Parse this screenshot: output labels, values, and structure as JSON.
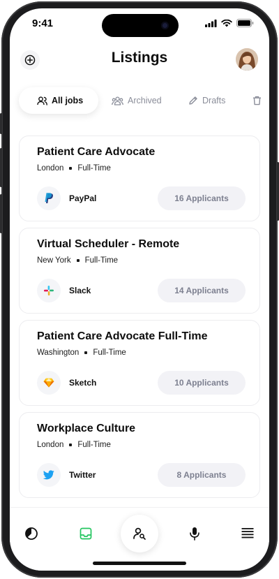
{
  "status_bar": {
    "time": "9:41"
  },
  "header": {
    "title": "Listings",
    "add_icon": "plus-circle-icon",
    "avatar_alt": "profile"
  },
  "tabs": [
    {
      "label": "All jobs",
      "icon": "users-icon",
      "active": true
    },
    {
      "label": "Archived",
      "icon": "group-icon",
      "active": false
    },
    {
      "label": "Drafts",
      "icon": "pencil-icon",
      "active": false
    },
    {
      "label": "",
      "icon": "trash-icon",
      "active": false
    }
  ],
  "listings": [
    {
      "title": "Patient Care Advocate",
      "location": "London",
      "type": "Full-Time",
      "company": "PayPal",
      "logo": "paypal-logo",
      "applicants": "16 Applicants"
    },
    {
      "title": "Virtual Scheduler - Remote",
      "location": "New York",
      "type": "Full-Time",
      "company": "Slack",
      "logo": "slack-logo",
      "applicants": "14 Applicants"
    },
    {
      "title": "Patient Care Advocate Full-Time",
      "location": "Washington",
      "type": "Full-Time",
      "company": "Sketch",
      "logo": "sketch-logo",
      "applicants": "10 Applicants"
    },
    {
      "title": "Workplace Culture",
      "location": "London",
      "type": "Full-Time",
      "company": "Twitter",
      "logo": "twitter-logo",
      "applicants": "8 Applicants"
    }
  ],
  "bottom_nav": [
    {
      "icon": "chart-pie-icon",
      "active": false
    },
    {
      "icon": "inbox-icon",
      "active": true
    },
    {
      "icon": "user-search-icon",
      "active": false
    },
    {
      "icon": "microphone-icon",
      "active": false
    },
    {
      "icon": "menu-lines-icon",
      "active": false
    }
  ],
  "colors": {
    "accent_green": "#22c55e",
    "applicants_bg": "#f2f2f6",
    "muted_text": "#8a8d99"
  }
}
